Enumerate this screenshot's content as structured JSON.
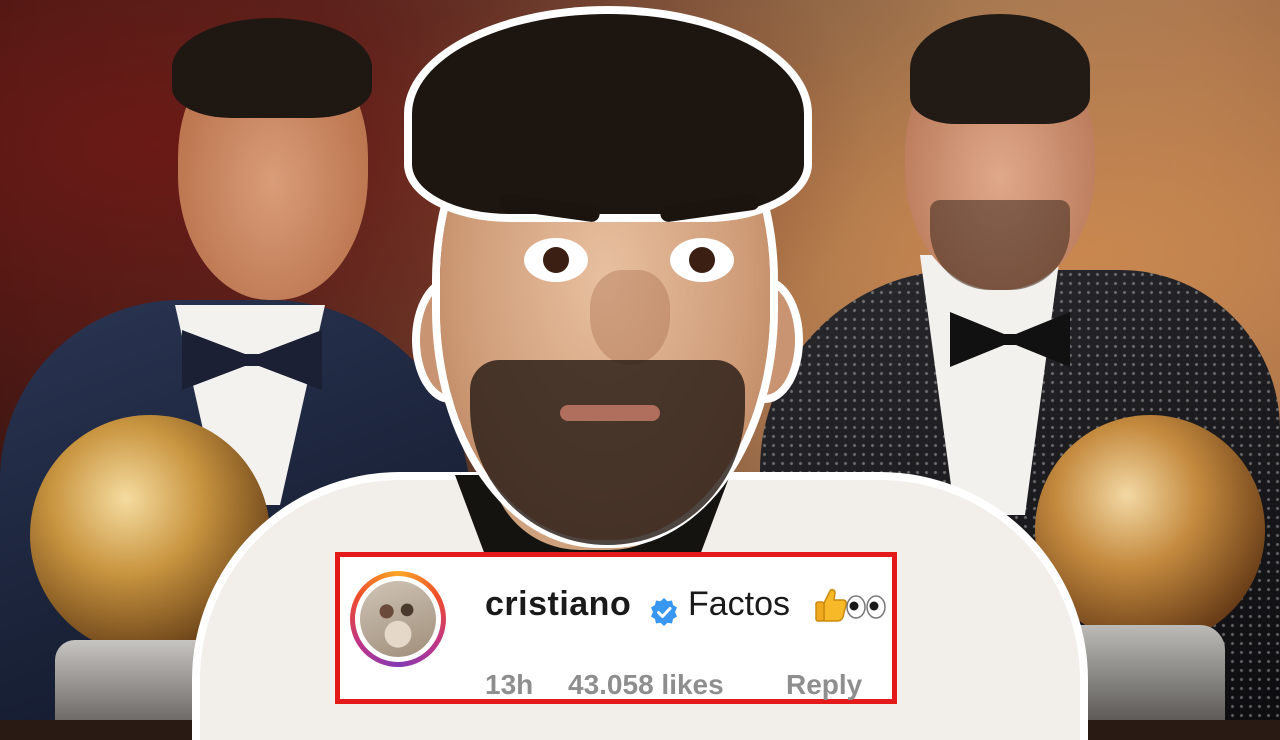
{
  "comment": {
    "username": "cristiano",
    "text": "Factos",
    "time": "13h",
    "likes": "43.058 likes",
    "reply": "Reply"
  },
  "icons": {
    "verified": "verified-badge-icon",
    "thumb": "thumbs-up-emoji",
    "eyes": "eyes-emoji"
  },
  "colors": {
    "highlight_border": "#e41a1a",
    "verified_blue": "#3897f0",
    "meta_gray": "#8e8e8e"
  }
}
